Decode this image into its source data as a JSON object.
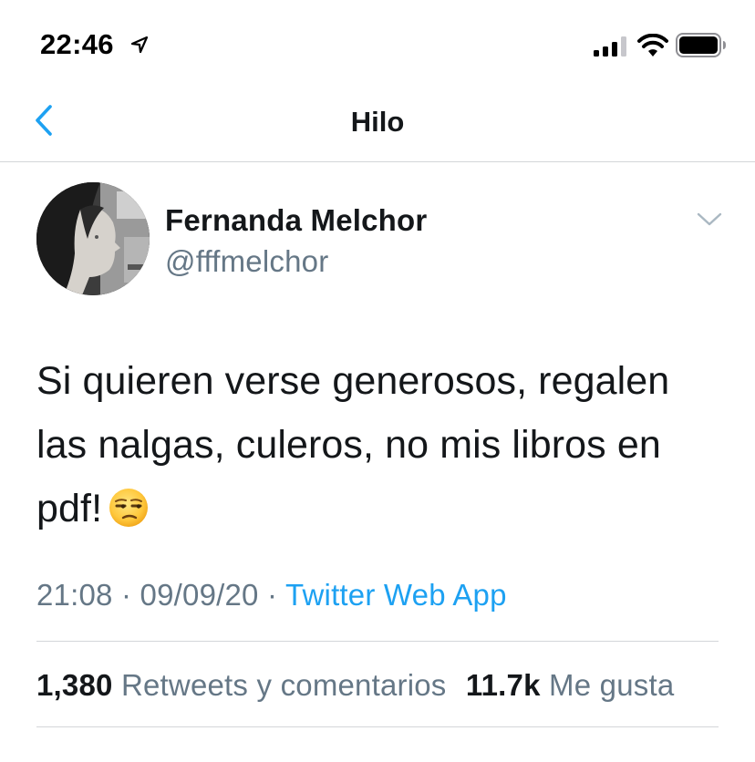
{
  "status_bar": {
    "time": "22:46",
    "icons": [
      "location-arrow-icon",
      "cellular-signal-icon",
      "wifi-icon",
      "battery-icon"
    ]
  },
  "nav": {
    "title": "Hilo",
    "back_icon": "chevron-left-icon"
  },
  "tweet": {
    "author_name": "Fernanda Melchor",
    "author_handle": "@fffmelchor",
    "text": "Si quieren verse generosos, regalen las nalgas, culeros, no mis libros en pdf!",
    "emoji": "unamused-face",
    "time": "21:08",
    "separator": "·",
    "date": "09/09/20",
    "source": "Twitter Web App",
    "retweets_count": "1,380",
    "retweets_label": "Retweets y comentarios",
    "likes_count": "11.7k",
    "likes_label": "Me gusta"
  },
  "colors": {
    "accent": "#1da1f2",
    "secondary_text": "#657786",
    "primary_text": "#14171a",
    "divider": "#d3d6d9"
  }
}
